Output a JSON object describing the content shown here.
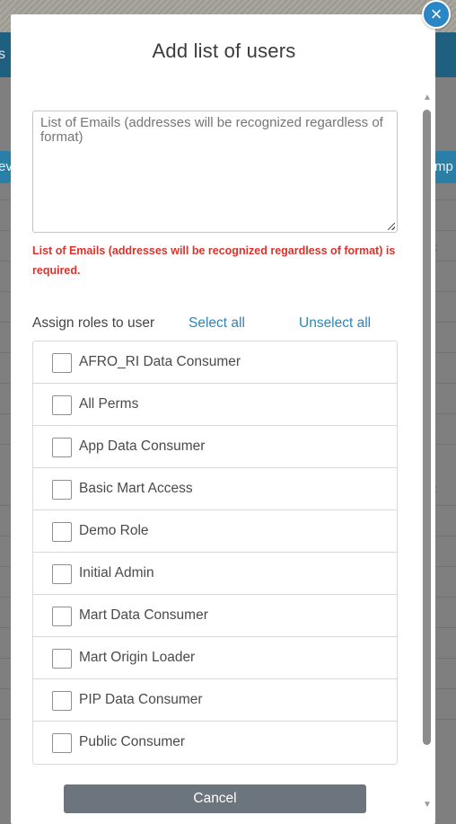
{
  "background": {
    "header_fragment": "s",
    "left_button_fragment": "ev",
    "right_button_fragment": "mp",
    "row_dots": ":"
  },
  "modal": {
    "title": "Add list of users",
    "emails": {
      "placeholder": "List of Emails (addresses will be recognized regardless of format)",
      "value": "",
      "error": "List of Emails (addresses will be recognized regardless of format) is required."
    },
    "roles": {
      "label": "Assign roles to user",
      "select_all": "Select all",
      "unselect_all": "Unselect all",
      "items": [
        {
          "label": "AFRO_RI Data Consumer",
          "checked": false
        },
        {
          "label": "All Perms",
          "checked": false
        },
        {
          "label": "App Data Consumer",
          "checked": false
        },
        {
          "label": "Basic Mart Access",
          "checked": false
        },
        {
          "label": "Demo Role",
          "checked": false
        },
        {
          "label": "Initial Admin",
          "checked": false
        },
        {
          "label": "Mart Data Consumer",
          "checked": false
        },
        {
          "label": "Mart Origin Loader",
          "checked": false
        },
        {
          "label": "PIP Data Consumer",
          "checked": false
        },
        {
          "label": "Public Consumer",
          "checked": false
        }
      ]
    },
    "cancel_label": "Cancel",
    "close_icon": "×"
  },
  "colors": {
    "accent": "#2a86ba",
    "error": "#e0302a",
    "cancel_button": "#6c757d",
    "close_button": "#2b86c5"
  },
  "icons": {
    "close": "close-icon",
    "resize": "resize-grip-icon",
    "scroll_up": "scroll-up-icon",
    "scroll_down": "scroll-down-icon"
  }
}
